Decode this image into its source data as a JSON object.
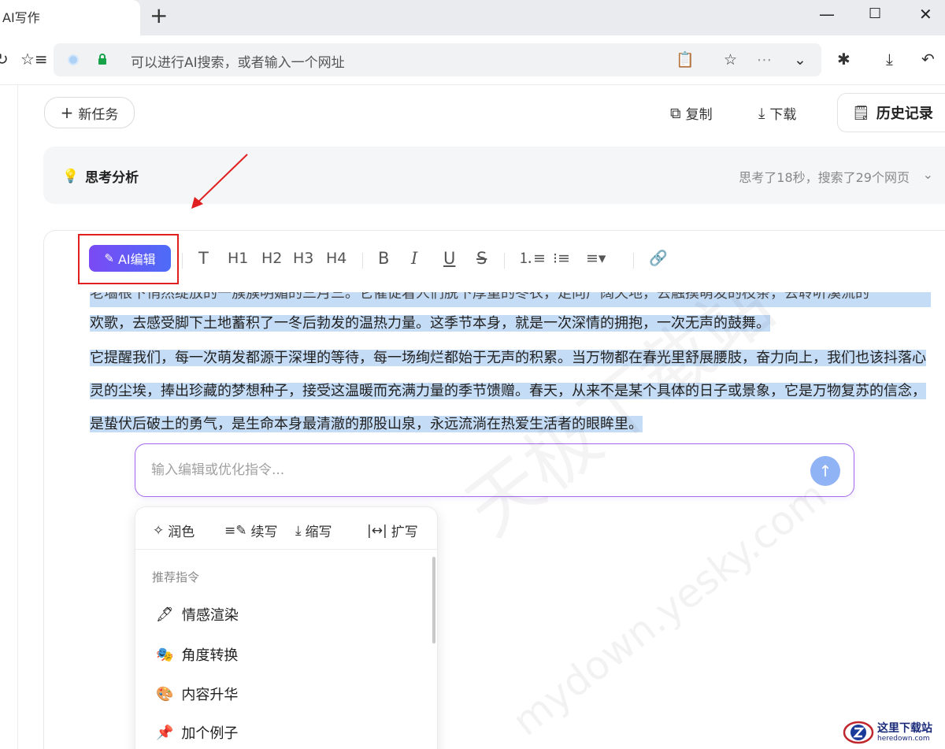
{
  "browser": {
    "tab_title": "AI写作",
    "new_tab": "+",
    "window_controls": {
      "minimize": "—",
      "maximize": "☐",
      "close": "✕"
    },
    "address_placeholder": "可以进行AI搜索，或者输入一个网址"
  },
  "header": {
    "new_task_label": "新任务",
    "copy_label": "复制",
    "download_label": "下载",
    "history_label": "历史记录"
  },
  "thinking": {
    "title": "思考分析",
    "meta": "思考了18秒，搜索了29个网页"
  },
  "editor_toolbar": {
    "ai_edit_label": "AI编辑",
    "buttons": [
      "T",
      "H1",
      "H2",
      "H3",
      "H4",
      "B",
      "I",
      "U",
      "S"
    ]
  },
  "content": {
    "clipped_line": "老墙根下悄然绽放的一簇簇明媚的三月三。它催促着人们脱下厚重的冬衣，走向广阔天地，去触摸萌发的枝条，去聆听溪流的",
    "paragraph_1": "欢歌，去感受脚下土地蓄积了一冬后勃发的温热力量。这季节本身，就是一次深情的拥抱，一次无声的鼓舞。",
    "paragraph_2": "它提醒我们，每一次萌发都源于深埋的等待，每一场绚烂都始于无声的积累。当万物都在春光里舒展腰肢，奋力向上，我们也该抖落心灵的尘埃，捧出珍藏的梦想种子，接受这温暖而充满力量的季节馈赠。春天，从来不是某个具体的日子或景象，它是万物复苏的信念，是蛰伏后破土的勇气，是生命本身最清澈的那股山泉，永远流淌在热爱生活者的眼眸里。"
  },
  "prompt": {
    "placeholder": "输入编辑或优化指令..."
  },
  "popup": {
    "tabs": [
      "润色",
      "续写",
      "缩写",
      "扩写"
    ],
    "section_title": "推荐指令",
    "items": [
      "情感渲染",
      "角度转换",
      "内容升华",
      "加个例子"
    ]
  },
  "watermark": {
    "text_cn": "天极下载站",
    "text_en": "mydown.yesky.com"
  },
  "brand": {
    "name_cn": "这里下载站",
    "name_en": "heredown.com"
  },
  "colors": {
    "accent_purple": "#7b4af5",
    "accent_blue": "#4d6cf7",
    "selection": "#c5dcf6",
    "highlight_red": "#e02020"
  }
}
